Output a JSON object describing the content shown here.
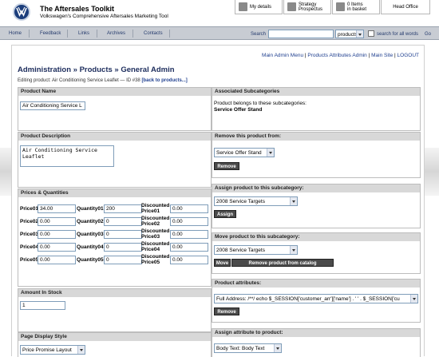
{
  "header": {
    "title": "The Aftersales Toolkit",
    "subtitle": "Volkswagen's Comprehensive Aftersales Marketing Tool",
    "tabs": [
      {
        "label": "My details",
        "icon": "user-icon"
      },
      {
        "label": "Strategy\nProspectus",
        "icon": "book-icon"
      },
      {
        "label": "0 Items\nin basket",
        "icon": "basket-icon"
      },
      {
        "label": "Head Office",
        "icon": ""
      }
    ]
  },
  "nav": {
    "items": [
      "Home",
      "Feedback",
      "Links",
      "Archives",
      "Contacts"
    ],
    "search_label": "Search",
    "search_value": "",
    "search_scope": "products",
    "search_all_label": "search for all words",
    "go_label": "Go"
  },
  "toplinks": {
    "main_menu": "Main Admin Menu",
    "attributes": "Products Attributes Admin",
    "main_site": "Main Site",
    "logout": "LOGOUT"
  },
  "page": {
    "title": "Administration » Products » General Admin",
    "editing_text": "Editing product: Air Conditioning Service Leaflet — ID #38",
    "back_link": "[back to products...]"
  },
  "product_name": {
    "header": "Product Name",
    "value": "Air Conditioning Service L"
  },
  "product_description": {
    "header": "Product Description",
    "value": "Air Conditioning Service\nLeaflet"
  },
  "prices": {
    "header": "Prices & Quantities",
    "rows": [
      {
        "price_label": "Price01",
        "price": "34.00",
        "qty_label": "Quantity01",
        "qty": "200",
        "disc_label": "Discounted\nPrice01",
        "disc": "0.00"
      },
      {
        "price_label": "Price02",
        "price": "0.00",
        "qty_label": "Quantity02",
        "qty": "0",
        "disc_label": "Discounted\nPrice02",
        "disc": "0.00"
      },
      {
        "price_label": "Price03",
        "price": "0.00",
        "qty_label": "Quantity03",
        "qty": "0",
        "disc_label": "Discounted\nPrice03",
        "disc": "0.00"
      },
      {
        "price_label": "Price04",
        "price": "0.00",
        "qty_label": "Quantity04",
        "qty": "0",
        "disc_label": "Discounted\nPrice04",
        "disc": "0.00"
      },
      {
        "price_label": "Price05",
        "price": "0.00",
        "qty_label": "Quantity05",
        "qty": "0",
        "disc_label": "Discounted\nPrice05",
        "disc": "0.00"
      }
    ]
  },
  "stock": {
    "header": "Amount In Stock",
    "value": "1"
  },
  "display_style": {
    "header": "Page Display Style",
    "value": "Price Promise Layout"
  },
  "assoc": {
    "header": "Associated Subcategories",
    "text": "Product belongs to these subcategories:",
    "item": "Service Offer Stand"
  },
  "remove_from": {
    "header": "Remove this product from:",
    "selected": "Service Offer Stand",
    "button": "Remove"
  },
  "assign_sub": {
    "header": "Assign product to this subcategory:",
    "selected": "2008 Service Targets",
    "button": "Assign"
  },
  "move_sub": {
    "header": "Move product to this subcategory:",
    "selected": "2008 Service Targets",
    "move_button": "Move",
    "remove_catalog_button": "Remove product from catalog"
  },
  "attributes": {
    "header": "Product attributes:",
    "selected": "Full Address: /**/ echo $_SESSION['customer_arr']['name'] . ' ' . $_SESSION['cu",
    "button": "Remove"
  },
  "assign_attr": {
    "header": "Assign attribute to product:",
    "selected": "Body Text: Body Text"
  }
}
